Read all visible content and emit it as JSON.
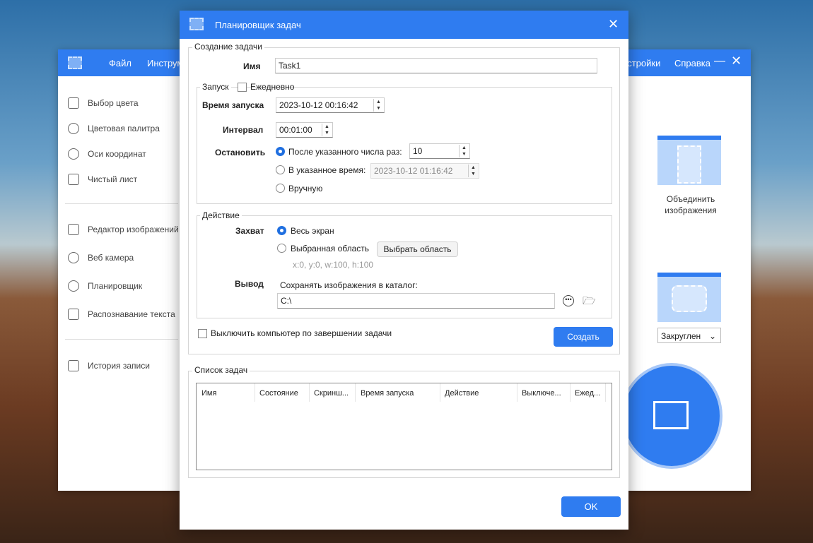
{
  "background_app": {
    "menu": [
      "Файл",
      "Инструм",
      "астройки",
      "Справка"
    ],
    "sidebar": [
      "Выбор цвета",
      "Цветовая палитра",
      "Оси координат",
      "Чистый лист",
      "Редактор изображений",
      "Веб камера",
      "Планировщик",
      "Распознавание текста",
      "История записи"
    ],
    "merge_label": "Объединить изображения",
    "shape_select": "Закруглен"
  },
  "dialog": {
    "title": "Планировщик задач",
    "create": {
      "legend": "Создание задачи",
      "name_label": "Имя",
      "name_value": "Task1",
      "launch": {
        "legend": "Запуск",
        "daily_label": "Ежедневно",
        "daily_checked": false,
        "time_label": "Время запуска",
        "time_value": "2023-10-12 00:16:42",
        "interval_label": "Интервал",
        "interval_value": "00:01:00",
        "stop_label": "Остановить",
        "stop_after": "После указанного числа раз:",
        "stop_after_value": "10",
        "stop_at": "В указанное время:",
        "stop_at_value": "2023-10-12 01:16:42",
        "stop_manual": "Вручную",
        "selected": "after"
      },
      "action": {
        "legend": "Действие",
        "capture_label": "Захват",
        "full_screen": "Весь экран",
        "area": "Выбранная область",
        "select_area_btn": "Выбрать область",
        "area_coords": "x:0, y:0, w:100, h:100",
        "output_label": "Вывод",
        "save_label": "Сохранять изображения в каталог:",
        "path": "C:\\"
      },
      "shutdown_label": "Выключить компьютер по завершении задачи",
      "create_btn": "Создать"
    },
    "tasks": {
      "legend": "Список задач",
      "columns": [
        "Имя",
        "Состояние",
        "Скринш...",
        "Время запуска",
        "Действие",
        "Выключе...",
        "Ежед..."
      ]
    },
    "ok_btn": "OK"
  },
  "colors": {
    "accent": "#2f7cf0"
  }
}
